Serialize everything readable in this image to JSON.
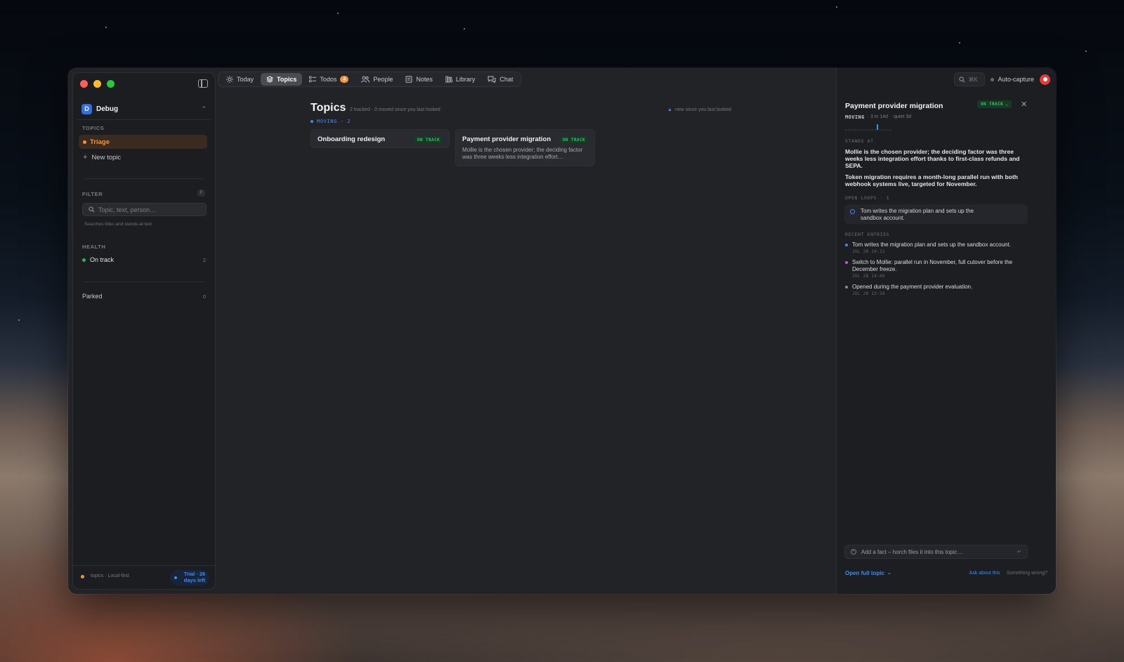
{
  "window": {
    "app_name": "Debug",
    "workspace_initial": "D"
  },
  "sidebar": {
    "topics_label": "TOPICS",
    "triage_label": "Triage",
    "new_topic_label": "New topic",
    "filter_label": "FILTER",
    "filter_shortcut": "F",
    "filter_placeholder": "Topic, text, person…",
    "filter_hint": "Searches titles and stands-at text",
    "health_label": "HEALTH",
    "health_items": [
      {
        "label": "On track",
        "count": "2",
        "color": "#2bb558"
      }
    ],
    "parked_label": "Parked",
    "parked_count": "0",
    "footer_text": "topics · Local-first",
    "trial_text": "Trial · 26 days left"
  },
  "nav": {
    "items": [
      {
        "label": "Today",
        "icon": "sun-icon"
      },
      {
        "label": "Topics",
        "icon": "layers-icon",
        "active": true
      },
      {
        "label": "Todos",
        "icon": "checklist-icon",
        "badge": "4"
      },
      {
        "label": "People",
        "icon": "people-icon"
      },
      {
        "label": "Notes",
        "icon": "note-icon"
      },
      {
        "label": "Library",
        "icon": "library-icon"
      },
      {
        "label": "Chat",
        "icon": "chat-icon"
      }
    ]
  },
  "main": {
    "title": "Topics",
    "subtitle": "2 tracked · 0 moved since you last looked",
    "new_since": "new since you last looked",
    "group_label": "MOVING · 2",
    "cards": [
      {
        "title": "Onboarding redesign",
        "status": "ON TRACK",
        "body": ""
      },
      {
        "title": "Payment provider migration",
        "status": "ON TRACK",
        "body": "Mollie is the chosen provider; the deciding factor was three weeks less integration effort…"
      }
    ]
  },
  "topbar_right": {
    "search_shortcut": "⌘K",
    "autocapture_label": "Auto-capture"
  },
  "detail": {
    "title": "Payment provider migration",
    "status": "ON TRACK",
    "meta_state": "MOVING",
    "meta_recent": "· 3 in 14d",
    "meta_quiet": "· quiet 3d",
    "stands_at_label": "STANDS AT",
    "stands_at": [
      "Mollie is the chosen provider; the deciding factor was three weeks less integration effort thanks to first-class refunds and SEPA.",
      "Token migration requires a month-long parallel run with both webhook systems live, targeted for November."
    ],
    "open_loops_label": "OPEN LOOPS · 1",
    "open_loops": [
      "Tom writes the migration plan and sets up the sandbox account."
    ],
    "recent_label": "RECENT ENTRIES",
    "entries": [
      {
        "text": "Tom writes the migration plan and sets up the sandbox account.",
        "time": "JUL 28 14:11",
        "color": "#3b8df7"
      },
      {
        "text": "Switch to Mollie: parallel run in November, full cutover before the December freeze.",
        "time": "JUL 28 14:06",
        "color": "#c45ad6"
      },
      {
        "text": "Opened during the payment provider evaluation.",
        "time": "JUL 28 13:56",
        "color": "#8a8b91"
      }
    ],
    "add_fact_placeholder": "Add a fact – horch files it into this topic…",
    "add_fact_enter": "↵",
    "open_full": "Open full topic",
    "ask": "Ask about this",
    "wrong": "Something wrong?"
  }
}
